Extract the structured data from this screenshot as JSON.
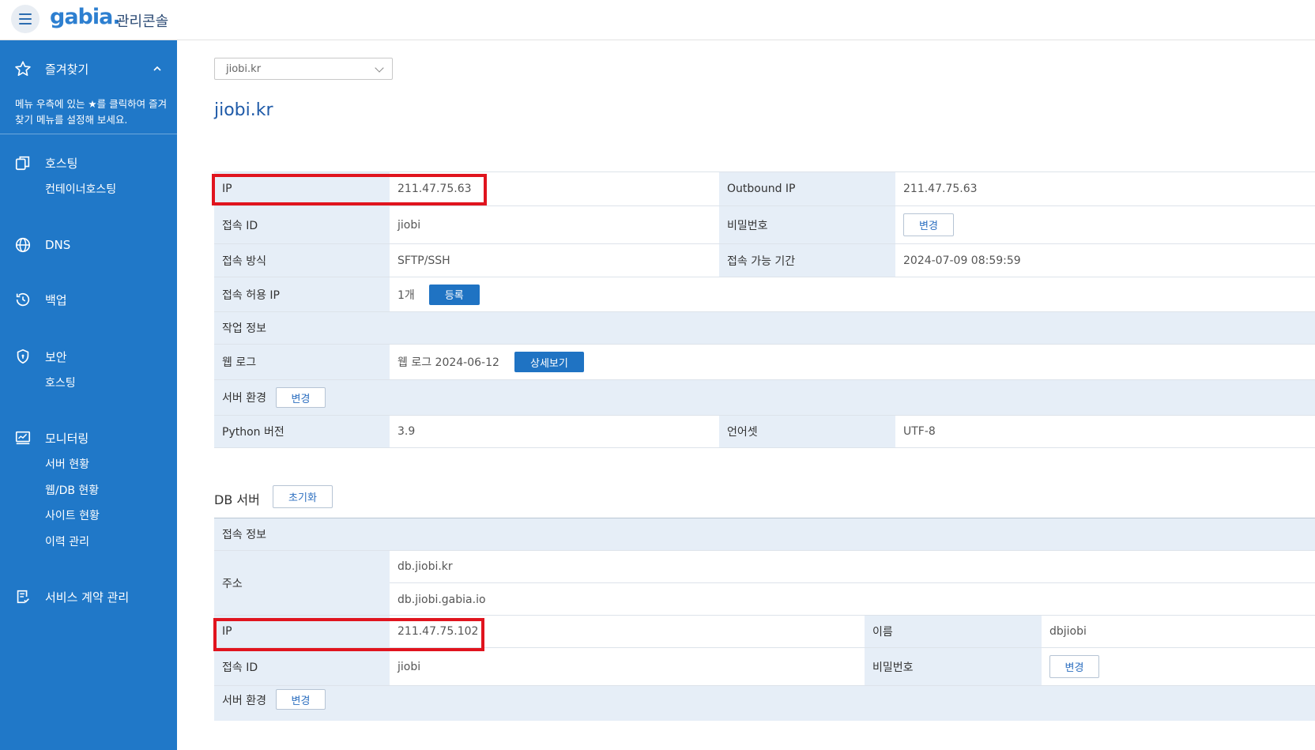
{
  "header": {
    "logo": "gabia.",
    "subtitle": "관리콘솔"
  },
  "sidebar": {
    "favorites": {
      "label": "즐겨찾기",
      "note": "메뉴 우측에 있는 ★를 클릭하여 즐겨찾기 메뉴를 설정해 보세요."
    },
    "hosting": {
      "label": "호스팅",
      "sub": [
        "컨테이너호스팅"
      ]
    },
    "dns": {
      "label": "DNS"
    },
    "backup": {
      "label": "백업"
    },
    "security": {
      "label": "보안",
      "sub": [
        "호스팅"
      ]
    },
    "monitoring": {
      "label": "모니터링",
      "sub": [
        "서버 현황",
        "웹/DB 현황",
        "사이트 현황",
        "이력 관리"
      ]
    },
    "contract": {
      "label": "서비스 계약 관리"
    }
  },
  "main": {
    "domain_select": "jiobi.kr",
    "title": "jiobi.kr",
    "web": {
      "ip_label": "IP",
      "ip_value": "211.47.75.63",
      "outbound_label": "Outbound IP",
      "outbound_value": "211.47.75.63",
      "id_label": "접속 ID",
      "id_value": "jiobi",
      "pw_label": "비밀번호",
      "pw_button": "변경",
      "method_label": "접속 방식",
      "method_value": "SFTP/SSH",
      "period_label": "접속 가능 기간",
      "period_value": "2024-07-09 08:59:59",
      "allow_label": "접속 허용 IP",
      "allow_value": "1개",
      "allow_button": "등록",
      "work_label": "작업 정보",
      "weblog_label": "웹 로그",
      "weblog_value": "웹 로그 2024-06-12",
      "weblog_button": "상세보기",
      "env_label": "서버 환경",
      "env_button": "변경",
      "python_label": "Python 버전",
      "python_value": "3.9",
      "charset_label": "언어셋",
      "charset_value": "UTF-8"
    },
    "db": {
      "section_title": "DB 서버",
      "reset_button": "초기화",
      "conn_label": "접속 정보",
      "addr_label": "주소",
      "addr_values": [
        "db.jiobi.kr",
        "db.jiobi.gabia.io"
      ],
      "ip_label": "IP",
      "ip_value": "211.47.75.102",
      "name_label": "이름",
      "name_value": "dbjiobi",
      "id_label": "접속 ID",
      "id_value": "jiobi",
      "pw_label": "비밀번호",
      "pw_button": "변경",
      "env_label": "서버 환경",
      "env_button": "변경"
    }
  },
  "colors": {
    "sidebar": "#2078c8",
    "accent": "#1f73c3",
    "highlight": "#e0141e",
    "header_cell": "#e6eef7"
  }
}
